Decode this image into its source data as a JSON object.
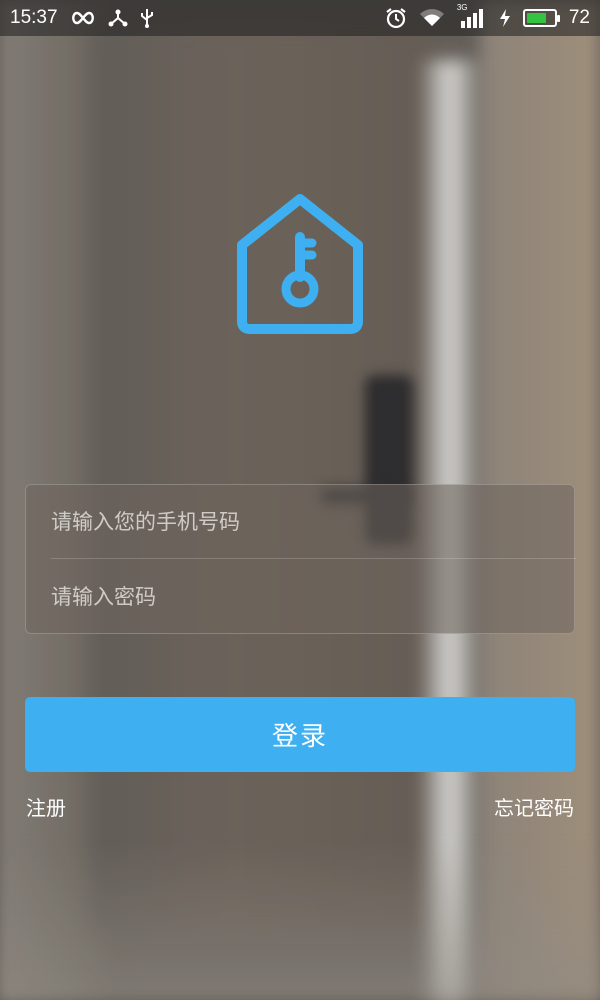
{
  "status_bar": {
    "time": "15:37",
    "battery_percent": "72",
    "battery_level": 0.72,
    "network_label": "3G",
    "icons_left": [
      "infinity-icon",
      "share-icon",
      "usb-icon"
    ],
    "icons_right": [
      "alarm-icon",
      "wifi-icon",
      "signal-icon",
      "charging-icon",
      "battery-icon"
    ]
  },
  "logo": {
    "icon": "house-key-icon",
    "color": "#3eb0f1"
  },
  "form": {
    "phone_placeholder": "请输入您的手机号码",
    "password_placeholder": "请输入密码"
  },
  "login_button": {
    "label": "登录",
    "color": "#3eb0f1"
  },
  "links": {
    "register": "注册",
    "forgot_password": "忘记密码"
  }
}
